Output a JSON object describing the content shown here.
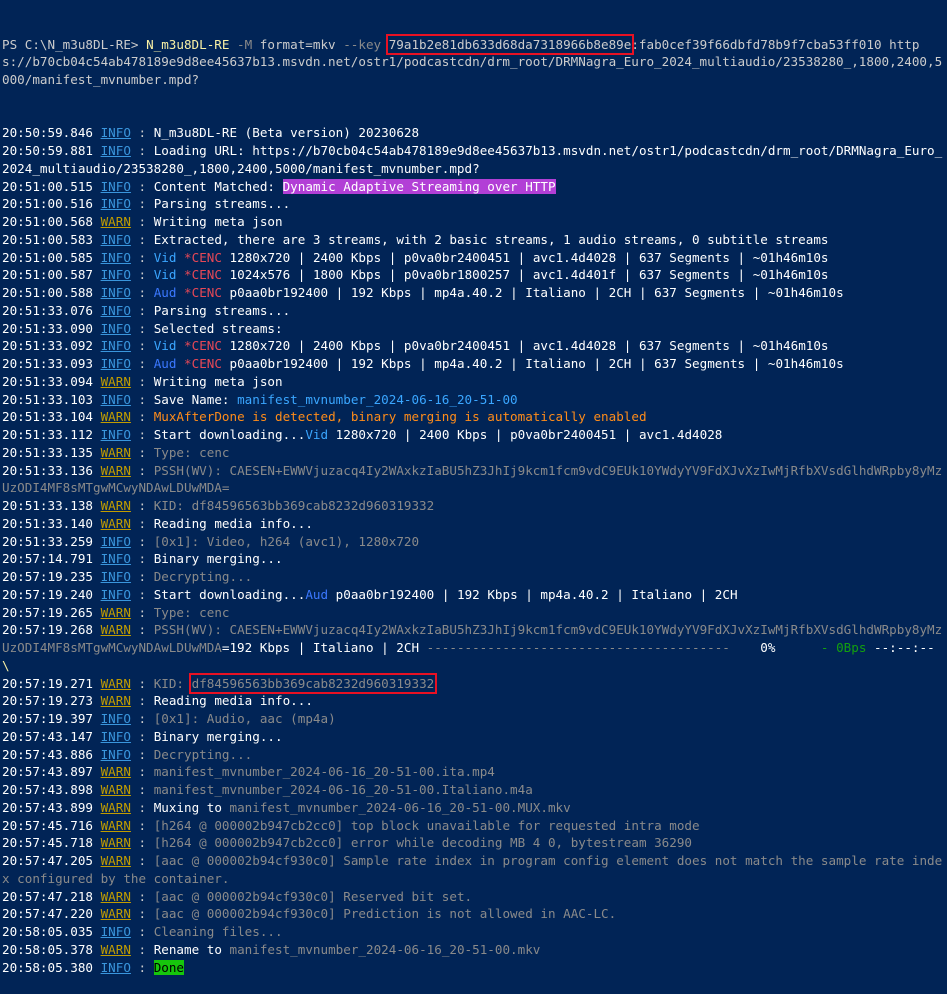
{
  "prompt": {
    "ps": "PS C:\\N_m3u8DL-RE> ",
    "exe": "N_m3u8DL-RE",
    "flag_m": " -M",
    "format": " format=mkv",
    "flag_key": " --key ",
    "key_highlighted": "79a1b2e81db633d68da7318966b8e89e",
    "key_rest": ":fab0cef39f66dbfd78b9f7cba53ff010",
    "url": " https://b70cb04c54ab478189e9d8ee45637b13.msvdn.net/ostr1/podcastcdn/drm_root/DRMNagra_Euro_2024_multiaudio/23538280_,1800,2400,5000/manifest_mvnumber.mpd?"
  },
  "lines": [
    {
      "t": "20:50:59.846",
      "lvl": "INFO",
      "msg": [
        {
          "x": "N_m3u8DL-RE (Beta version) 20230628"
        }
      ]
    },
    {
      "t": "20:50:59.881",
      "lvl": "INFO",
      "msg": [
        {
          "x": "Loading URL: https://b70cb04c54ab478189e9d8ee45637b13.msvdn.net/ostr1/podcastcdn/drm_root/DRMNagra_Euro_2024_multiaudio/23538280_,1800,2400,5000/manifest_mvnumber.mpd?"
        }
      ]
    },
    {
      "t": "20:51:00.515",
      "lvl": "INFO",
      "msg": [
        {
          "x": "Content Matched: "
        },
        {
          "x": "Dynamic Adaptive Streaming over HTTP",
          "c": "magenta-bg"
        }
      ]
    },
    {
      "t": "20:51:00.516",
      "lvl": "INFO",
      "msg": [
        {
          "x": "Parsing streams..."
        }
      ]
    },
    {
      "t": "20:51:00.568",
      "lvl": "WARN",
      "msg": [
        {
          "x": "Writing meta json"
        }
      ]
    },
    {
      "t": "20:51:00.583",
      "lvl": "INFO",
      "msg": [
        {
          "x": "Extracted, there are 3 streams, with 2 basic streams, 1 audio streams, 0 subtitle streams"
        }
      ]
    },
    {
      "t": "20:51:00.585",
      "lvl": "INFO",
      "msg": [
        {
          "x": "Vid",
          "c": "cyan"
        },
        {
          "x": " "
        },
        {
          "x": "*CENC",
          "c": "red"
        },
        {
          "x": " 1280x720 | 2400 Kbps | p0va0br2400451 | avc1.4d4028 | 637 Segments | ~01h46m10s"
        }
      ]
    },
    {
      "t": "20:51:00.587",
      "lvl": "INFO",
      "msg": [
        {
          "x": "Vid",
          "c": "cyan"
        },
        {
          "x": " "
        },
        {
          "x": "*CENC",
          "c": "red"
        },
        {
          "x": " 1024x576 | 1800 Kbps | p0va0br1800257 | avc1.4d401f | 637 Segments | ~01h46m10s"
        }
      ]
    },
    {
      "t": "20:51:00.588",
      "lvl": "INFO",
      "msg": [
        {
          "x": "Aud",
          "c": "blue"
        },
        {
          "x": " "
        },
        {
          "x": "*CENC",
          "c": "red"
        },
        {
          "x": " p0aa0br192400 | 192 Kbps | mp4a.40.2 | Italiano | 2CH | 637 Segments | ~01h46m10s"
        }
      ]
    },
    {
      "t": "20:51:33.076",
      "lvl": "INFO",
      "msg": [
        {
          "x": "Parsing streams..."
        }
      ]
    },
    {
      "t": "20:51:33.090",
      "lvl": "INFO",
      "msg": [
        {
          "x": "Selected streams:"
        }
      ]
    },
    {
      "t": "20:51:33.092",
      "lvl": "INFO",
      "msg": [
        {
          "x": "Vid",
          "c": "cyan"
        },
        {
          "x": " "
        },
        {
          "x": "*CENC",
          "c": "red"
        },
        {
          "x": " 1280x720 | 2400 Kbps | p0va0br2400451 | avc1.4d4028 | 637 Segments | ~01h46m10s"
        }
      ]
    },
    {
      "t": "20:51:33.093",
      "lvl": "INFO",
      "msg": [
        {
          "x": "Aud",
          "c": "blue"
        },
        {
          "x": " "
        },
        {
          "x": "*CENC",
          "c": "red"
        },
        {
          "x": " p0aa0br192400 | 192 Kbps | mp4a.40.2 | Italiano | 2CH | 637 Segments | ~01h46m10s"
        }
      ]
    },
    {
      "t": "20:51:33.094",
      "lvl": "WARN",
      "msg": [
        {
          "x": "Writing meta json"
        }
      ]
    },
    {
      "t": "20:51:33.103",
      "lvl": "INFO",
      "msg": [
        {
          "x": "Save Name: "
        },
        {
          "x": "manifest_mvnumber_2024-06-16_20-51-00",
          "c": "cyan"
        }
      ]
    },
    {
      "t": "20:51:33.104",
      "lvl": "WARN",
      "msg": [
        {
          "x": "MuxAfterDone is detected, binary merging is automatically enabled",
          "c": "orange"
        }
      ]
    },
    {
      "t": "20:51:33.112",
      "lvl": "INFO",
      "msg": [
        {
          "x": "Start downloading..."
        },
        {
          "x": "Vid",
          "c": "cyan"
        },
        {
          "x": " 1280x720 | 2400 Kbps | p0va0br2400451 | avc1.4d4028"
        }
      ]
    },
    {
      "t": "20:51:33.135",
      "lvl": "WARN",
      "msg": [
        {
          "x": "Type: cenc",
          "c": "dim"
        }
      ]
    },
    {
      "t": "20:51:33.136",
      "lvl": "WARN",
      "msg": [
        {
          "x": "PSSH(WV): CAESEN+EWWVjuzacq4Iy2WAxkzIaBU5hZ3JhIj9kcm1fcm9vdC9EUk10YWdyYV9FdXJvXzIwMjRfbXVsdGlhdWRpby8yMzUzODI4MF8sMTgwMCwyNDAwLDUwMDA=",
          "c": "dim"
        }
      ]
    },
    {
      "t": "20:51:33.138",
      "lvl": "WARN",
      "msg": [
        {
          "x": "KID: df84596563bb369cab8232d960319332",
          "c": "dim"
        }
      ]
    },
    {
      "t": "20:51:33.140",
      "lvl": "WARN",
      "msg": [
        {
          "x": "Reading media info..."
        }
      ]
    },
    {
      "t": "20:51:33.259",
      "lvl": "INFO",
      "msg": [
        {
          "x": "[0x1]: Video, h264 (avc1), 1280x720",
          "c": "dim"
        }
      ]
    },
    {
      "t": "20:57:14.791",
      "lvl": "INFO",
      "msg": [
        {
          "x": "Binary merging..."
        }
      ]
    },
    {
      "t": "20:57:19.235",
      "lvl": "INFO",
      "msg": [
        {
          "x": "Decrypting...",
          "c": "dim"
        }
      ]
    },
    {
      "t": "20:57:19.240",
      "lvl": "INFO",
      "msg": [
        {
          "x": "Start downloading..."
        },
        {
          "x": "Aud",
          "c": "blue"
        },
        {
          "x": " p0aa0br192400 | 192 Kbps | mp4a.40.2 | Italiano | 2CH"
        }
      ]
    },
    {
      "t": "20:57:19.265",
      "lvl": "WARN",
      "msg": [
        {
          "x": "Type: cenc",
          "c": "dim"
        }
      ]
    },
    {
      "t": "20:57:19.268",
      "lvl": "WARN",
      "msg": [
        {
          "x": "PSSH(WV): CAESEN+EWWVjuzacq4Iy2WAxkzIaBU5hZ3JhIj9kcm1fcm9vdC9EUk10YWdyYV9FdXJvXzIwMjRfbXVsdGlhdWRpby8yMzUzODI4MF8sMTgwMCwyNDAwLDUwMDA",
          "c": "dim"
        },
        {
          "x": "=192 Kbps | Italiano | 2CH "
        },
        {
          "x": "----------------------------------------",
          "c": "dim"
        },
        {
          "x": "    0%      "
        },
        {
          "x": "- 0Bps",
          "c": "green"
        },
        {
          "x": " --:--:-- "
        },
        {
          "x": "\\",
          "c": "yellow"
        }
      ]
    },
    {
      "t": "20:57:19.271",
      "lvl": "WARN",
      "msg": [
        {
          "x": "KID: ",
          "c": "dim"
        },
        {
          "x": "df84596563bb369cab8232d960319332",
          "c": "dim",
          "box": true
        }
      ]
    },
    {
      "t": "20:57:19.273",
      "lvl": "WARN",
      "msg": [
        {
          "x": "Reading media info..."
        }
      ]
    },
    {
      "t": "20:57:19.397",
      "lvl": "INFO",
      "msg": [
        {
          "x": "[0x1]: Audio, aac (mp4a)",
          "c": "dim"
        }
      ]
    },
    {
      "t": "20:57:43.147",
      "lvl": "INFO",
      "msg": [
        {
          "x": "Binary merging..."
        }
      ]
    },
    {
      "t": "20:57:43.886",
      "lvl": "INFO",
      "msg": [
        {
          "x": "Decrypting...",
          "c": "dim"
        }
      ]
    },
    {
      "t": "20:57:43.897",
      "lvl": "WARN",
      "msg": [
        {
          "x": "manifest_mvnumber_2024-06-16_20-51-00.ita.mp4",
          "c": "dim"
        }
      ]
    },
    {
      "t": "20:57:43.898",
      "lvl": "WARN",
      "msg": [
        {
          "x": "manifest_mvnumber_2024-06-16_20-51-00.Italiano.m4a",
          "c": "dim"
        }
      ]
    },
    {
      "t": "20:57:43.899",
      "lvl": "WARN",
      "msg": [
        {
          "x": "Muxing to "
        },
        {
          "x": "manifest_mvnumber_2024-06-16_20-51-00.MUX.mkv",
          "c": "dim"
        }
      ]
    },
    {
      "t": "20:57:45.716",
      "lvl": "WARN",
      "msg": [
        {
          "x": "[h264 @ 000002b947cb2cc0] top block unavailable for requested intra mode",
          "c": "dim"
        }
      ]
    },
    {
      "t": "20:57:45.718",
      "lvl": "WARN",
      "msg": [
        {
          "x": "[h264 @ 000002b947cb2cc0] error while decoding MB 4 0, bytestream 36290",
          "c": "dim"
        }
      ]
    },
    {
      "t": "20:57:47.205",
      "lvl": "WARN",
      "msg": [
        {
          "x": "[aac @ 000002b94cf930c0] Sample rate index in program config element does not match the sample rate index configured by the container.",
          "c": "dim"
        }
      ]
    },
    {
      "t": "20:57:47.218",
      "lvl": "WARN",
      "msg": [
        {
          "x": "[aac @ 000002b94cf930c0] Reserved bit set.",
          "c": "dim"
        }
      ]
    },
    {
      "t": "20:57:47.220",
      "lvl": "WARN",
      "msg": [
        {
          "x": "[aac @ 000002b94cf930c0] Prediction is not allowed in AAC-LC.",
          "c": "dim"
        }
      ]
    },
    {
      "t": "20:58:05.035",
      "lvl": "INFO",
      "msg": [
        {
          "x": "Cleaning files...",
          "c": "dim"
        }
      ]
    },
    {
      "t": "20:58:05.378",
      "lvl": "WARN",
      "msg": [
        {
          "x": "Rename to "
        },
        {
          "x": "manifest_mvnumber_2024-06-16_20-51-00.mkv",
          "c": "dim"
        }
      ]
    },
    {
      "t": "20:58:05.380",
      "lvl": "INFO",
      "msg": [
        {
          "x": "Done",
          "c": "green-bg"
        }
      ]
    }
  ],
  "colors": {
    "background": "#012456",
    "info": "#3a96dd",
    "warn": "#c19c00",
    "highlight_box": "#e81123"
  }
}
